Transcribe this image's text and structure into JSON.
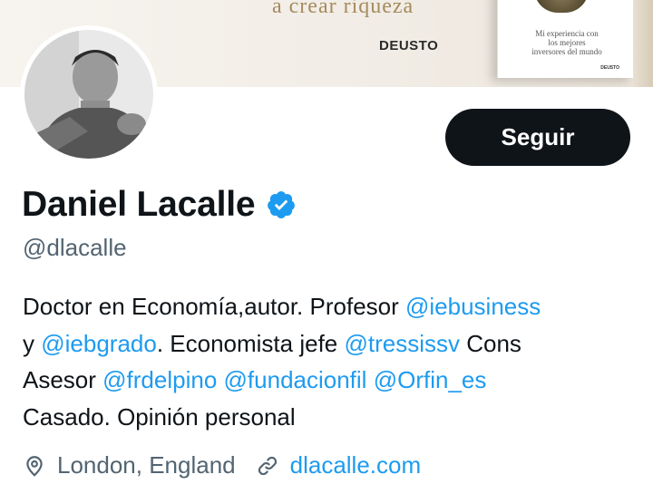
{
  "banner": {
    "tagline": "a crear riqueza",
    "publisher": "DEUSTO",
    "book_text": "Mi experiencia con\nlos mejores\ninversores del mundo",
    "book_brand": "DEUSTO"
  },
  "profile": {
    "display_name": "Daniel Lacalle",
    "handle": "@dlacalle",
    "follow_label": "Seguir",
    "verified_icon": "verified-badge-icon",
    "colors": {
      "accent": "#1d9bf0",
      "button": "#0f1419",
      "secondary_text": "#536471"
    }
  },
  "bio": {
    "line1_text": "Doctor en Economía,autor. Profesor ",
    "line1_mention": "@iebusiness",
    "line2_prefix": "y ",
    "line2_mention1": "@iebgrado",
    "line2_mid": ". Economista jefe ",
    "line2_mention2": "@tressissv",
    "line2_suffix": " Cons",
    "line3_prefix": "Asesor ",
    "line3_mention1": "@frdelpino",
    "line3_mention2": "@fundacionfil",
    "line3_mention3": "@Orfin_es",
    "line4": "Casado. Opinión personal"
  },
  "meta": {
    "location_icon": "location-pin-icon",
    "location": "London, England",
    "link_icon": "link-icon",
    "website": "dlacalle.com"
  }
}
